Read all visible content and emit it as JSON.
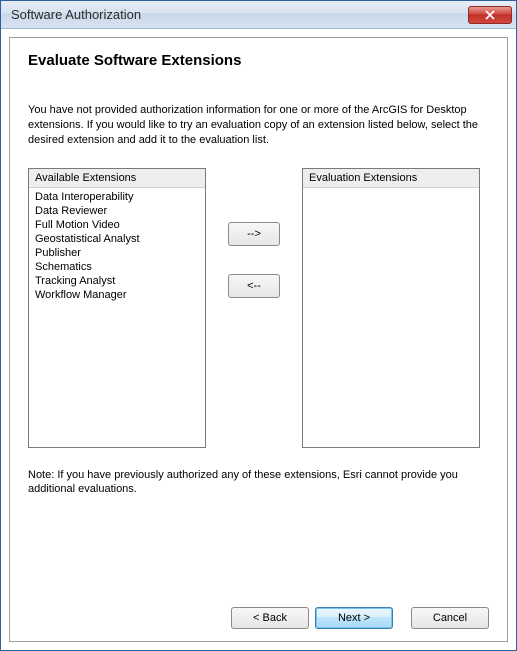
{
  "window": {
    "title": "Software Authorization"
  },
  "heading": "Evaluate Software Extensions",
  "description": "You have not provided authorization information for one or more of the ArcGIS for Desktop extensions.  If you would like to try an evaluation copy of an extension listed below, select the desired extension and add it to the evaluation list.",
  "available": {
    "header": "Available Extensions",
    "items": [
      "Data Interoperability",
      "Data Reviewer",
      "Full Motion Video",
      "Geostatistical Analyst",
      "Publisher",
      "Schematics",
      "Tracking Analyst",
      "Workflow Manager"
    ]
  },
  "evaluation": {
    "header": "Evaluation Extensions",
    "items": []
  },
  "buttons": {
    "add": "-->",
    "remove": "<--"
  },
  "note": "Note:  If you have previously authorized any of these extensions, Esri cannot provide you additional evaluations.",
  "footer": {
    "back": "< Back",
    "next": "Next >",
    "cancel": "Cancel"
  }
}
